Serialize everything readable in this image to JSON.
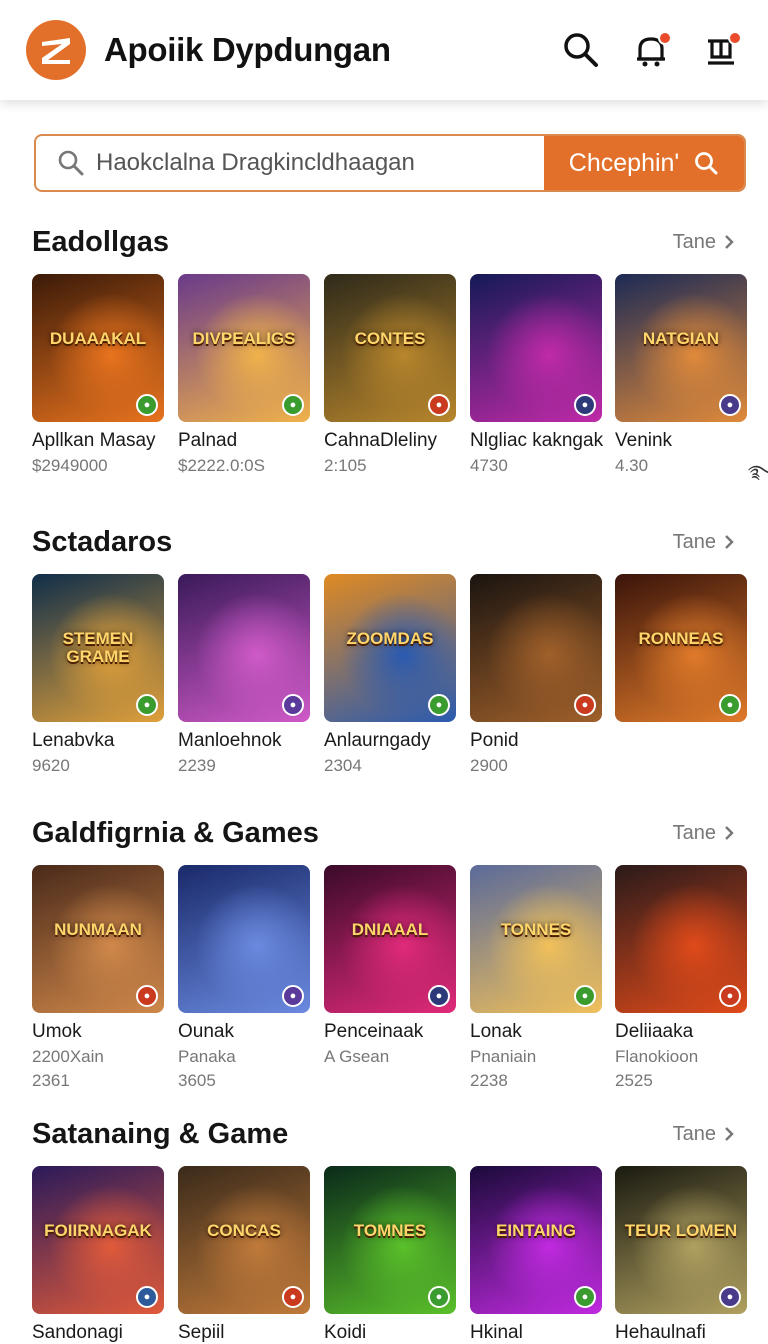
{
  "header": {
    "title": "Apoiik Dypdungan",
    "icons": [
      "search-icon",
      "notification-icon",
      "cart-icon"
    ]
  },
  "search": {
    "placeholder": "Haokclalna Dragkincldhaagan",
    "button_label": "Chcephin'"
  },
  "sections": [
    {
      "title": "Eadollgas",
      "more": "Tane",
      "items": [
        {
          "name": "Apllkan Masay",
          "meta1": "$2949000",
          "meta2": "",
          "art": "DUAAAKAL",
          "c1": "#3b1a08",
          "c2": "#e8731e",
          "badge": "#3a9b2f"
        },
        {
          "name": "Palnad",
          "meta1": "$2222.0:0S",
          "meta2": "",
          "art": "DIVPEALIGS",
          "c1": "#6a3a8a",
          "c2": "#f0b24a",
          "badge": "#3a9b2f"
        },
        {
          "name": "CahnaDleliny",
          "meta1": "2:105",
          "meta2": "",
          "art": "CONTES",
          "c1": "#2e2a1a",
          "c2": "#b8862c",
          "badge": "#c93a1f"
        },
        {
          "name": "Nlgliac kakngak",
          "meta1": "4730",
          "meta2": "",
          "art": "",
          "c1": "#141a55",
          "c2": "#c02aa8",
          "badge": "#2d3a7a"
        },
        {
          "name": "Venink",
          "meta1": "4.30",
          "meta2": "",
          "art": "NATGIAN",
          "c1": "#1c2a55",
          "c2": "#e08a3a",
          "badge": "#4a3a8a"
        }
      ]
    },
    {
      "title": "Sctadaros",
      "more": "Tane",
      "items": [
        {
          "name": "Lenabvka",
          "meta1": "9620",
          "meta2": "",
          "art": "STEMEN GRAME",
          "c1": "#0f2e4a",
          "c2": "#e0a03a",
          "badge": "#3a9b2f"
        },
        {
          "name": "Manloehnok",
          "meta1": "2239",
          "meta2": "",
          "art": "",
          "c1": "#3a1a5a",
          "c2": "#d05ac8",
          "badge": "#5a3a9a"
        },
        {
          "name": "Anlaurngady",
          "meta1": "2304",
          "meta2": "",
          "art": "ZOOMDAS",
          "c1": "#e08a22",
          "c2": "#2a5ab0",
          "badge": "#3a9b2f"
        },
        {
          "name": "Ponid",
          "meta1": "2900",
          "meta2": "",
          "art": "",
          "c1": "#1a1410",
          "c2": "#a0602a",
          "badge": "#c93a1f"
        },
        {
          "name": "",
          "meta1": "",
          "meta2": "",
          "art": "RONNEAS",
          "c1": "#3a140a",
          "c2": "#e07a2a",
          "badge": "#3a9b2f"
        }
      ]
    },
    {
      "title": "Galdfigrnia & Games",
      "more": "Tane",
      "items": [
        {
          "name": "Umok",
          "meta1": "2200Xain",
          "meta2": "2361",
          "art": "NUNMAAN",
          "c1": "#4a2a1a",
          "c2": "#d0884a",
          "badge": "#c93a1f"
        },
        {
          "name": "Ounak",
          "meta1": "Panaka",
          "meta2": "3605",
          "art": "",
          "c1": "#1a2a6a",
          "c2": "#6a8ae0",
          "badge": "#5a3a9a"
        },
        {
          "name": "Penceinaak",
          "meta1": "A Gsean",
          "meta2": "",
          "art": "DNIAAAL",
          "c1": "#3a0a2a",
          "c2": "#e02a7a",
          "badge": "#2d3a7a"
        },
        {
          "name": "Lonak",
          "meta1": "Pnaniain",
          "meta2": "2238",
          "art": "TONNES",
          "c1": "#5a6a9a",
          "c2": "#f0c05a",
          "badge": "#3a9b2f"
        },
        {
          "name": "Deliiaaka",
          "meta1": "Flanokioon",
          "meta2": "2525",
          "art": "",
          "c1": "#2a1a1a",
          "c2": "#e04a1a",
          "badge": "#c93a1f"
        }
      ]
    },
    {
      "title": "Satanaing & Game",
      "more": "Tane",
      "items": [
        {
          "name": "Sandonagi",
          "meta1": "",
          "meta2": "",
          "art": "FOIIRNAGAK",
          "c1": "#2a1a5a",
          "c2": "#e05a3a",
          "badge": "#2d5a9a"
        },
        {
          "name": "Sepiil",
          "meta1": "",
          "meta2": "",
          "art": "CONCAS",
          "c1": "#3a2a1a",
          "c2": "#c07a3a",
          "badge": "#c93a1f"
        },
        {
          "name": "Koidi",
          "meta1": "",
          "meta2": "",
          "art": "TOMNES",
          "c1": "#0a2a1a",
          "c2": "#5ac02a",
          "badge": "#3a9b2f"
        },
        {
          "name": "Hkinal",
          "meta1": "",
          "meta2": "",
          "art": "EINTAING",
          "c1": "#1a0a3a",
          "c2": "#c02ae0",
          "badge": "#3a9b2f"
        },
        {
          "name": "Hehaulnafi",
          "meta1": "",
          "meta2": "",
          "art": "TEUR LOMEN",
          "c1": "#1a1a10",
          "c2": "#b0a060",
          "badge": "#4a3a8a"
        }
      ]
    }
  ],
  "edge_glyph": " ࿐࿐",
  "colors": {
    "accent": "#e2702a",
    "text": "#1a1a1a",
    "muted": "#777777"
  }
}
